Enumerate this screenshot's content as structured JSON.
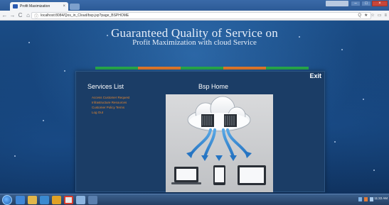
{
  "browser": {
    "tab_title": "Profit Maximization",
    "tab_close": "×",
    "url": "localhost:8084/Qos_in_Cloud/bsp.jsp?page_BSPHOME",
    "nav": {
      "back": "←",
      "forward": "→",
      "reload": "C",
      "home": "⌂",
      "info": "ⓘ"
    },
    "right_icons": [
      "Q",
      "★",
      "☆",
      "▭",
      "≡"
    ],
    "window_buttons": {
      "minimize": "–",
      "maximize": "□",
      "close": "×"
    }
  },
  "page": {
    "title_line1": "Guaranteed Quality of Service on",
    "title_line2": "Profit Maximization with cloud Service",
    "colorbar": [
      "#27a84a",
      "#e0782a",
      "#27a84a",
      "#e0782a",
      "#27a84a"
    ],
    "exit_label": "Exit",
    "services_title": "Services List",
    "home_title": "Bsp Home",
    "menu": [
      "Access Customer Request",
      "Infrastructure Resources",
      "Customer Policy Terms",
      "Log Out"
    ],
    "illustration": "cloud-computing-illustration"
  },
  "taskbar": {
    "clock_time": "11:22 AM",
    "clock_date": "",
    "apps": [
      "ie-icon",
      "folder-icon",
      "media-icon",
      "chrome-icon",
      "app-icon",
      "app2-icon"
    ]
  },
  "colors": {
    "menu_link": "#e4862f",
    "panel": "#1b3d66",
    "background": "#1a4c86"
  }
}
